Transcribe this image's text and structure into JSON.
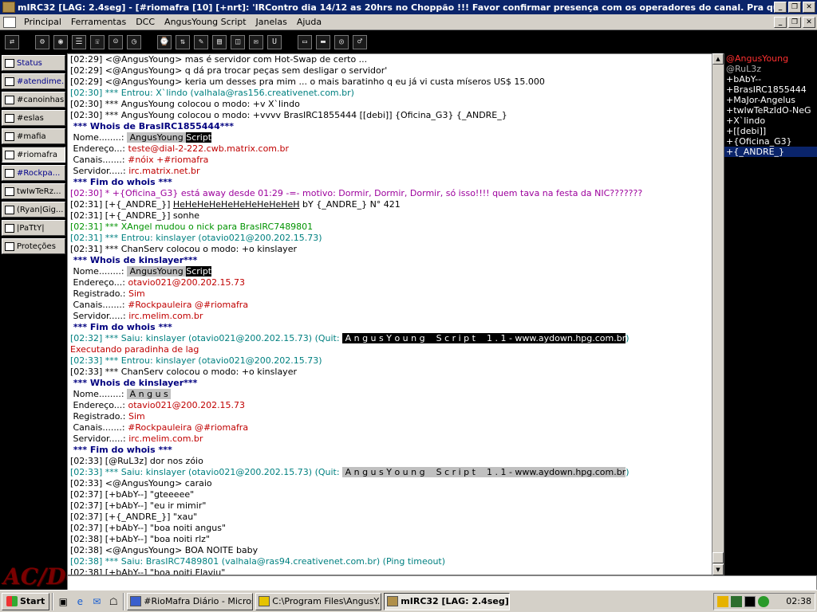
{
  "window": {
    "title": "mIRC32 [LAG: 2.4seg] - [#riomafra [10] [+nrt]: 'IRContro dia 14/12 as 20hrs no Choppão !!! Favor confirmar presença com os operadores do canal. Pra quem já tá]"
  },
  "menu": {
    "items": [
      "Principal",
      "Ferramentas",
      "DCC",
      "AngusYoung Script",
      "Janelas",
      "Ajuda"
    ]
  },
  "toolbar": {
    "icons": [
      "connect-icon",
      "options-icon",
      "globe-icon",
      "list-icon",
      "address-icon",
      "notify-icon",
      "away-icon",
      "timer-icon",
      "dcc-icon",
      "log-icon",
      "channel-icon",
      "bookmark-icon",
      "note-icon",
      "url-icon",
      "tile-icon",
      "cascade-icon",
      "about-icon",
      "bell-icon"
    ]
  },
  "switchbar": {
    "items": [
      {
        "label": "Status",
        "highlight": true
      },
      {
        "label": "#atendime...",
        "highlight": true
      },
      {
        "label": "#canoinhas",
        "highlight": false
      },
      {
        "label": "#eslas",
        "highlight": false
      },
      {
        "label": "#mafia",
        "highlight": false
      },
      {
        "label": "#riomafra",
        "highlight": false,
        "active": true
      },
      {
        "label": "#Rockpa...",
        "highlight": true
      },
      {
        "label": "twIwTeRz...",
        "highlight": false
      },
      {
        "label": "(Ryan|Gig...",
        "highlight": false
      },
      {
        "label": "|PaTtY|",
        "highlight": false
      },
      {
        "label": "Proteções",
        "highlight": false
      }
    ],
    "logo_text": "AC/DC"
  },
  "chat": {
    "lines": [
      [
        {
          "t": "[02:29] <@AngusYoung> mas é servidor com Hot-Swap de certo ..."
        }
      ],
      [
        {
          "t": "[02:29] <@AngusYoung> q dá pra trocar peças sem desligar o servidor'"
        }
      ],
      [
        {
          "t": "[02:29] <@AngusYoung> keria um desses pra mim ... o mais baratinho q eu já vi custa míseros US$ 15.000"
        }
      ],
      [
        {
          "t": "[02:30] *** Entrou: X`lindo (valhala@ras156.creativenet.com.br)",
          "c": "teal"
        }
      ],
      [
        {
          "t": "[02:30] *** AngusYoung colocou o modo: +v X`lindo"
        }
      ],
      [
        {
          "t": "[02:30] *** AngusYoung colocou o modo: +vvvv BrasIRC1855444 [[debi]] {Oficina_G3} {_ANDRE_}"
        }
      ],
      [
        {
          "t": " *** Whois de BrasIRC1855444***",
          "c": "navy"
        }
      ],
      [
        {
          "t": " Nome........: "
        },
        {
          "t": " AngusYoung ",
          "c": "hlgray"
        },
        {
          "t": "Script",
          "c": "hlblack"
        }
      ],
      [
        {
          "t": " Endereço...: "
        },
        {
          "t": "teste@dial-2-222.cwb.matrix.com.br",
          "c": "red"
        }
      ],
      [
        {
          "t": " Canais.......: "
        },
        {
          "t": "#nóix +#riomafra",
          "c": "red"
        }
      ],
      [
        {
          "t": " Servidor.....: "
        },
        {
          "t": "irc.matrix.net.br",
          "c": "red"
        }
      ],
      [
        {
          "t": " *** Fim do whois ***",
          "c": "navy"
        }
      ],
      [
        {
          "t": "[02:30] * +{Oficina_G3} está away desde 01:29 -=- motivo: Dormir, Dormir, Dormir, só isso!!!! quem tava na festa da NIC???????",
          "c": "purple"
        }
      ],
      [
        {
          "t": "[02:31] [+{_ANDRE_}] "
        },
        {
          "t": "HeHeHeHeHeHeHeHeHeHeH",
          "c": "ul"
        },
        {
          "t": " bY {_ANDRE_} N° 421"
        }
      ],
      [
        {
          "t": "[02:31] [+{_ANDRE_}] sonhe"
        }
      ],
      [
        {
          "t": "[02:31] *** XAngel mudou o nick para BrasIRC7489801",
          "c": "green"
        }
      ],
      [
        {
          "t": "[02:31] *** Entrou: kinslayer (otavio021@200.202.15.73)",
          "c": "teal"
        }
      ],
      [
        {
          "t": "[02:31] *** ChanServ colocou o modo: +o kinslayer"
        }
      ],
      [
        {
          "t": " *** Whois de kinslayer***",
          "c": "navy"
        }
      ],
      [
        {
          "t": " Nome........: "
        },
        {
          "t": " AngusYoung ",
          "c": "hlgray"
        },
        {
          "t": "Script",
          "c": "hlblack"
        }
      ],
      [
        {
          "t": " Endereço...: "
        },
        {
          "t": "otavio021@200.202.15.73",
          "c": "red"
        }
      ],
      [
        {
          "t": " Registrado.: "
        },
        {
          "t": "Sim",
          "c": "red"
        }
      ],
      [
        {
          "t": " Canais.......: "
        },
        {
          "t": "#Rockpauleira @#riomafra",
          "c": "red"
        }
      ],
      [
        {
          "t": " Servidor.....: "
        },
        {
          "t": "irc.melim.com.br",
          "c": "red"
        }
      ],
      [
        {
          "t": " *** Fim do whois ***",
          "c": "navy"
        }
      ],
      [
        {
          "t": "[02:32] *** Saiu: kinslayer (otavio021@200.202.15.73) (Quit: ",
          "c": "teal"
        },
        {
          "t": " A n g u s Y o u n g    S c r i p t    1 . 1 - www.aydown.hpg.com.br",
          "c": "hlblack"
        },
        {
          "t": ")",
          "c": "teal"
        }
      ],
      [
        {
          "t": "Executando paradinha de lag",
          "c": "red"
        }
      ],
      [
        {
          "t": "[02:33] *** Entrou: kinslayer (otavio021@200.202.15.73)",
          "c": "teal"
        }
      ],
      [
        {
          "t": "[02:33] *** ChanServ colocou o modo: +o kinslayer"
        }
      ],
      [
        {
          "t": " *** Whois de kinslayer***",
          "c": "navy"
        }
      ],
      [
        {
          "t": " Nome........: "
        },
        {
          "t": " A n g u s ",
          "c": "hlgray"
        }
      ],
      [
        {
          "t": " Endereço...: "
        },
        {
          "t": "otavio021@200.202.15.73",
          "c": "red"
        }
      ],
      [
        {
          "t": " Registrado.: "
        },
        {
          "t": "Sim",
          "c": "red"
        }
      ],
      [
        {
          "t": " Canais.......: "
        },
        {
          "t": "#Rockpauleira @#riomafra",
          "c": "red"
        }
      ],
      [
        {
          "t": " Servidor.....: "
        },
        {
          "t": "irc.melim.com.br",
          "c": "red"
        }
      ],
      [
        {
          "t": " *** Fim do whois ***",
          "c": "navy"
        }
      ],
      [
        {
          "t": "[02:33] [@RuL3z] dor nos zóio"
        }
      ],
      [
        {
          "t": "[02:33] *** Saiu: kinslayer (otavio021@200.202.15.73) (Quit: ",
          "c": "teal"
        },
        {
          "t": " A n g u s Y o u n g    S c r i p t    1 . 1 - www.aydown.hpg.com.br",
          "c": "hlgray"
        },
        {
          "t": ")",
          "c": "teal"
        }
      ],
      [
        {
          "t": "[02:33] <@AngusYoung> caraio"
        }
      ],
      [
        {
          "t": "[02:37] [+bAbY--] \"gteeeee\""
        }
      ],
      [
        {
          "t": "[02:37] [+bAbY--] \"eu ir mimir\""
        }
      ],
      [
        {
          "t": "[02:37] [+{_ANDRE_}] \"xau\""
        }
      ],
      [
        {
          "t": "[02:37] [+bAbY--] \"boa noiti angus\""
        }
      ],
      [
        {
          "t": "[02:38] [+bAbY--] \"boa noiti rlz\""
        }
      ],
      [
        {
          "t": "[02:38] <@AngusYoung> BOA NOITE baby"
        }
      ],
      [
        {
          "t": "[02:38] *** Saiu: BrasIRC7489801 (valhala@ras94.creativenet.com.br) (Ping timeout)",
          "c": "teal"
        }
      ],
      [
        {
          "t": "[02:38] [+bAbY--] \"boa noiti Flaviu\""
        }
      ]
    ]
  },
  "nicklist": {
    "nicks": [
      {
        "n": "@AngusYoung",
        "op": true
      },
      {
        "n": "@RuL3z",
        "dim": true
      },
      {
        "n": "+bAbY--"
      },
      {
        "n": "+BrasIRC1855444"
      },
      {
        "n": "+MaJor-Angelus"
      },
      {
        "n": "+twIwTeRzIdO-NeG"
      },
      {
        "n": "+X`lindo"
      },
      {
        "n": "+[[debi]]"
      },
      {
        "n": "+{Oficina_G3}"
      },
      {
        "n": "+{_ANDRE_}",
        "sel": true
      }
    ]
  },
  "taskbar": {
    "start_label": "Start",
    "tasks": [
      {
        "label": "#RioMafra Diário - Micros...",
        "active": false
      },
      {
        "label": "C:\\Program Files\\AngusY...",
        "active": false
      },
      {
        "label": "mIRC32 [LAG: 2.4seg] ...",
        "active": true
      }
    ],
    "clock": "02:38"
  },
  "colors": {
    "title_bg": "#0a246a",
    "chat_bg": "#ffffff",
    "nicklist_bg": "#000000",
    "op_nick": "#ff3030",
    "join_part": "#008080",
    "whois_value": "#c00000",
    "action": "#9c009c",
    "nick_change": "#009300",
    "whois_header": "#00007f"
  }
}
